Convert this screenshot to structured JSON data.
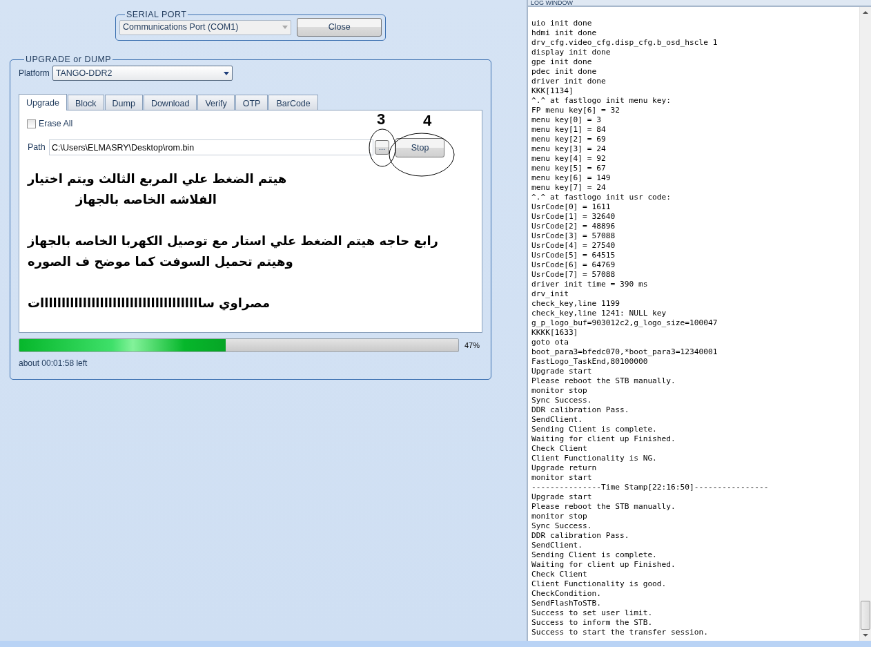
{
  "serial_port": {
    "legend": "SERIAL PORT",
    "port": "Communications Port (COM1)",
    "button": "Close"
  },
  "upgrade": {
    "legend": "UPGRADE or DUMP",
    "platform_label": "Platform",
    "platform": "TANGO-DDR2",
    "tabs": [
      {
        "label": "Upgrade",
        "selected": true
      },
      {
        "label": "Block",
        "selected": false
      },
      {
        "label": "Dump",
        "selected": false
      },
      {
        "label": "Download",
        "selected": false
      },
      {
        "label": "Verify",
        "selected": false
      },
      {
        "label": "OTP",
        "selected": false
      },
      {
        "label": "BarCode",
        "selected": false
      }
    ],
    "erase_all": {
      "label": "Erase All",
      "checked": false
    },
    "path_label": "Path",
    "path": "C:\\Users\\ELMASRY\\Desktop\\rom.bin",
    "browse_button": "...",
    "stop_button": "Stop",
    "progress": {
      "level": 0.47,
      "reading": "47%"
    },
    "time_left": "about 00:01:58 left"
  },
  "annotations": {
    "marks": [
      "3",
      "4"
    ],
    "notes": [
      "هيتم الضغط علي المربع الثالث  ويتم اختيار",
      "الفلاشه الخاصه بالجهاز",
      "رابع حاجه هيتم الضغط علي استار مع توصيل الكهربا الخاصه بالجهاز",
      "وهيتم تحميل السوفت كما موضح ف الصوره",
      "مصراوي ساااااااااااااااااااااااااااااااااااااات"
    ]
  },
  "log_window": {
    "title": "LOG WINDOW",
    "lines": [
      "uio init done",
      "hdmi init done",
      "drv_cfg.video_cfg.disp_cfg.b_osd_hscle 1",
      "display init done",
      "gpe init done",
      "pdec init done",
      "driver init done",
      "KKK[1134]",
      "^.^ at fastlogo init menu key:",
      "FP menu key[6] = 32",
      "menu key[0] = 3",
      "menu key[1] = 84",
      "menu key[2] = 69",
      "menu key[3] = 24",
      "menu key[4] = 92",
      "menu key[5] = 67",
      "menu key[6] = 149",
      "menu key[7] = 24",
      "^.^ at fastlogo init usr code:",
      "UsrCode[0] = 1611",
      "UsrCode[1] = 32640",
      "UsrCode[2] = 48896",
      "UsrCode[3] = 57088",
      "UsrCode[4] = 27540",
      "UsrCode[5] = 64515",
      "UsrCode[6] = 64769",
      "UsrCode[7] = 57088",
      "driver init time = 390 ms",
      "drv_init",
      "check_key,line 1199",
      "check_key,line 1241: NULL key",
      "g_p_logo_buf=903012c2,g_logo_size=100047",
      "KKKK[1633]",
      "goto ota",
      "boot_para3=bfedc070,*boot_para3=12340001",
      "FastLogo_TaskEnd,80100000",
      "Upgrade start",
      "Please reboot the STB manually.",
      "monitor stop",
      "Sync Success.",
      "DDR calibration Pass.",
      "SendClient.",
      "Sending Client is complete.",
      "Waiting for client up Finished.",
      "Check Client",
      "Client Functionality is NG.",
      "Upgrade return",
      "monitor start",
      "---------------Time Stamp[22:16:50]----------------",
      "Upgrade start",
      "Please reboot the STB manually.",
      "monitor stop",
      "Sync Success.",
      "DDR calibration Pass.",
      "SendClient.",
      "Sending Client is complete.",
      "Waiting for client up Finished.",
      "Check Client",
      "Client Functionality is good.",
      "CheckCondition.",
      "SendFlashToSTB.",
      "Success to set user limit.",
      "Success to inform the STB.",
      "Success to start the transfer session."
    ]
  }
}
